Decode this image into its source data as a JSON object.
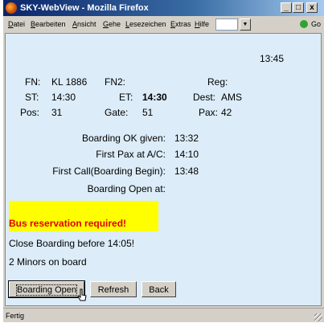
{
  "window": {
    "title": "SKY-WebView - Mozilla Firefox",
    "controls": {
      "minimize": "_",
      "maximize": "□",
      "close": "x"
    }
  },
  "menubar": {
    "items": [
      "Datei",
      "Bearbeiten",
      "Ansicht",
      "Gehe",
      "Lesezeichen",
      "Extras",
      "Hilfe"
    ],
    "go_label": "Go"
  },
  "page": {
    "time": "13:45",
    "flight": {
      "fn_label": "FN:",
      "fn_value": "KL 1886",
      "fn2_label": "FN2:",
      "fn2_value": "",
      "reg_label": "Reg:",
      "reg_value": "",
      "st_label": "ST:",
      "st_value": "14:30",
      "et_label": "ET:",
      "et_value": "14:30",
      "dest_label": "Dest:",
      "dest_value": "AMS",
      "pos_label": "Pos:",
      "pos_value": "31",
      "gate_label": "Gate:",
      "gate_value": "51",
      "pax_label": "Pax:",
      "pax_value": "42"
    },
    "boarding": [
      {
        "label": "Boarding OK given:",
        "value": "13:32"
      },
      {
        "label": "First Pax at A/C:",
        "value": "14:10"
      },
      {
        "label": "First Call(Boarding Begin):",
        "value": "13:48"
      },
      {
        "label": "Boarding Open at:",
        "value": ""
      }
    ],
    "warning": "Bus reservation required!",
    "notes": [
      "Close Boarding before 14:05!",
      "2 Minors on board"
    ],
    "buttons": {
      "boarding_open": "Boarding Open",
      "refresh": "Refresh",
      "back": "Back"
    }
  },
  "statusbar": {
    "text": "Fertig"
  },
  "colors": {
    "content_bg": "#dcecf8",
    "banner_bg": "#ffff00",
    "warning_text": "#e00000",
    "titlebar": "#0a246a"
  }
}
